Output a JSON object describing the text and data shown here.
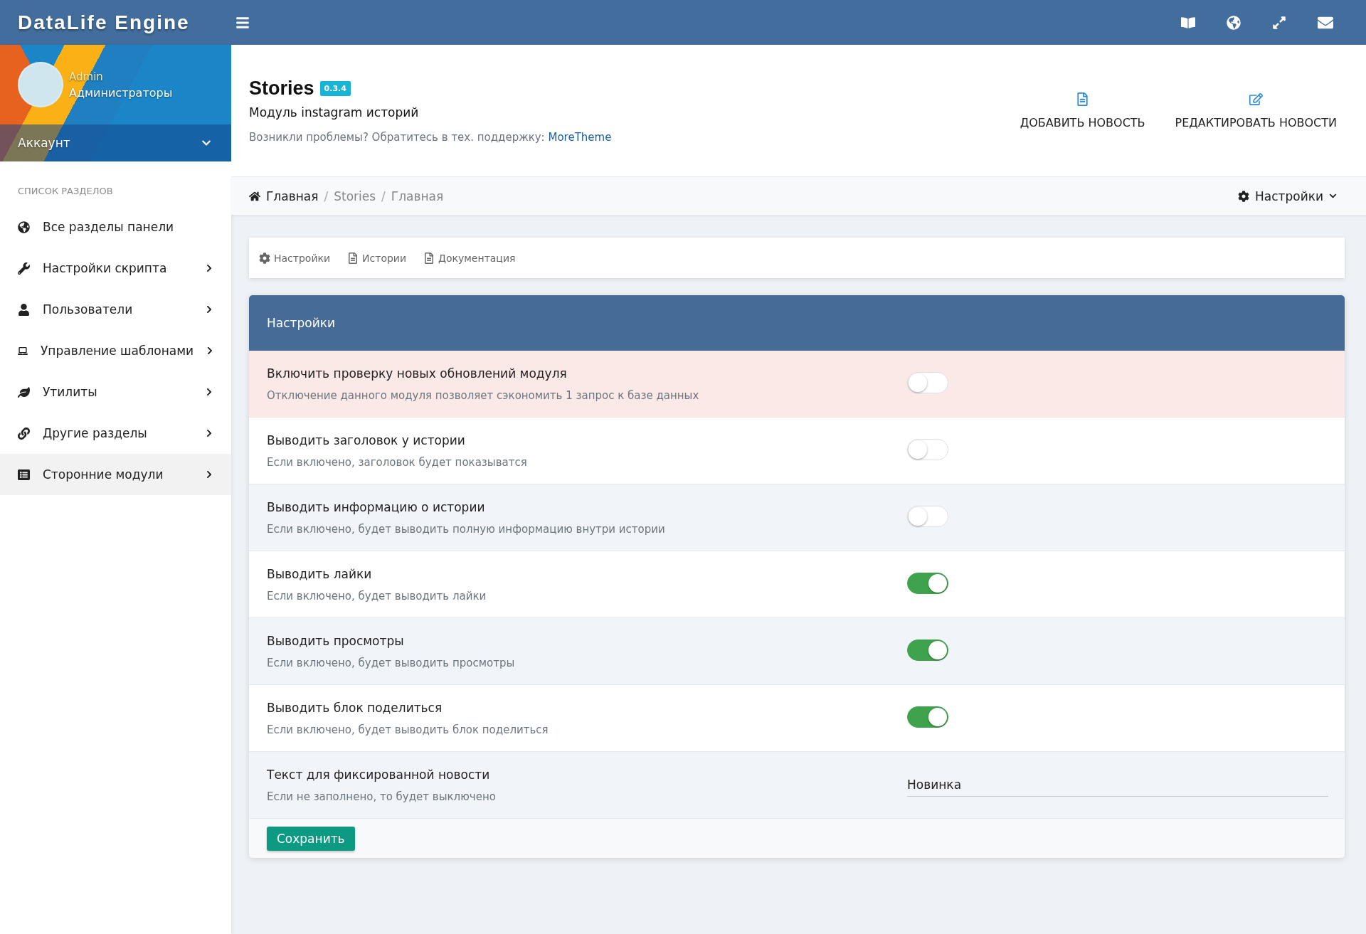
{
  "topbar": {
    "brand": "DataLife Engine"
  },
  "user": {
    "name": "Admin",
    "group": "Администраторы",
    "account_label": "Аккаунт"
  },
  "sidebar": {
    "heading": "СПИСОК РАЗДЕЛОВ",
    "items": [
      {
        "label": "Все разделы панели",
        "expandable": false,
        "selected": false
      },
      {
        "label": "Настройки скрипта",
        "expandable": true,
        "selected": false
      },
      {
        "label": "Пользователи",
        "expandable": true,
        "selected": false
      },
      {
        "label": "Управление шаблонами",
        "expandable": true,
        "selected": false
      },
      {
        "label": "Утилиты",
        "expandable": true,
        "selected": false
      },
      {
        "label": "Другие разделы",
        "expandable": true,
        "selected": false
      },
      {
        "label": "Сторонние модули",
        "expandable": true,
        "selected": true
      }
    ]
  },
  "module": {
    "title": "Stories",
    "version": "0.3.4",
    "subtitle": "Модуль instagram историй",
    "support_text": "Возникли проблемы? Обратитесь в тех. поддержку:",
    "support_link": "MoreTheme"
  },
  "actions": [
    "ДОБАВИТЬ НОВОСТЬ",
    "РЕДАКТИРОВАТЬ НОВОСТИ"
  ],
  "breadcrumb": [
    "Главная",
    "Stories",
    "Главная"
  ],
  "breadcrumb_separator": "/",
  "settings_menu": "Настройки",
  "tabs": [
    "Настройки",
    "Истории",
    "Документация"
  ],
  "panel": {
    "title": "Настройки",
    "rows": [
      {
        "kind": "toggle",
        "title": "Включить проверку новых обновлений модуля",
        "description": "Отключение данного модуля позволяет сэкономить 1 запрос к базе данных",
        "highlighted": true,
        "on": false
      },
      {
        "kind": "toggle",
        "title": "Выводить заголовок у истории",
        "description": "Если включено, заголовок будет показыватся",
        "highlighted": false,
        "on": false
      },
      {
        "kind": "toggle",
        "title": "Выводить информацию о истории",
        "description": "Если включено, будет выводить полную информацию внутри истории",
        "highlighted": false,
        "on": false
      },
      {
        "kind": "toggle",
        "title": "Выводить лайки",
        "description": "Если включено, будет выводить лайки",
        "highlighted": false,
        "on": true
      },
      {
        "kind": "toggle",
        "title": "Выводить просмотры",
        "description": "Если включено, будет выводить просмотры",
        "highlighted": false,
        "on": true
      },
      {
        "kind": "toggle",
        "title": "Выводить блок поделиться",
        "description": "Если включено, будет выводить блок поделиться",
        "highlighted": false,
        "on": true
      },
      {
        "kind": "text",
        "title": "Текст для фиксированной новости",
        "description": "Если не заполнено, то будет выключено",
        "highlighted": false,
        "value": "Новинка"
      }
    ],
    "save_button": "Сохранить"
  }
}
